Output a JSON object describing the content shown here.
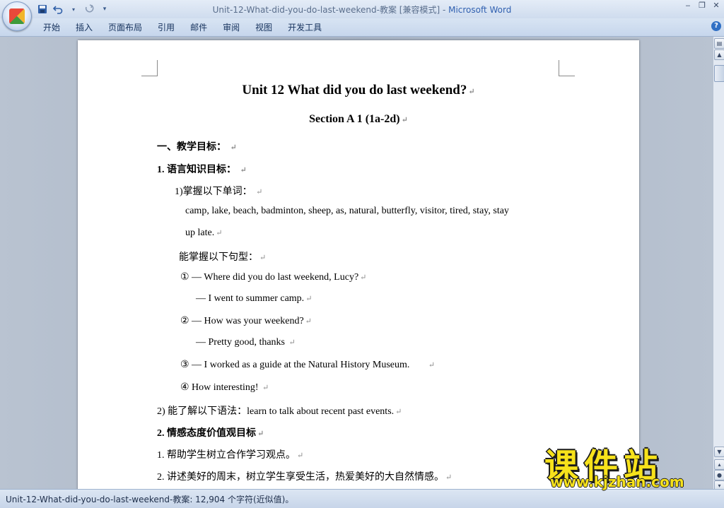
{
  "titlebar": {
    "doc_name": "Unit-12-What-did-you-do-last-weekend-教案 [兼容模式] - ",
    "app_name": "Microsoft Word",
    "qat_save_icon": "save-icon",
    "qat_undo_icon": "undo-icon",
    "qat_redo_icon": "redo-icon"
  },
  "ribbon": {
    "tabs": [
      "开始",
      "插入",
      "页面布局",
      "引用",
      "邮件",
      "审阅",
      "视图",
      "开发工具"
    ]
  },
  "document": {
    "title": "Unit 12 What did you do last weekend?",
    "section": "Section A 1 (1a-2d)",
    "h1": "一、教学目标：",
    "h2": "1. 语言知识目标：",
    "vocab_head": "1)掌握以下单词：",
    "vocab_line1": "camp, lake, beach, badminton, sheep, as, natural, butterfly, visitor, tired, stay, stay",
    "vocab_line2": "up late.",
    "patterns_head": "能掌握以下句型：",
    "s1": "① — Where did you do last weekend, Lucy?",
    "s1a": "— I went to summer camp.",
    "s2": "② — How was your weekend?",
    "s2a": "— Pretty good, thanks",
    "s3": "③ — I worked as a guide at the Natural History Museum.",
    "s4": "④ How interesting!",
    "grammar": "2) 能了解以下语法：learn to talk about recent past events.",
    "h3": "2. 情感态度价值观目标",
    "aim1": "1. 帮助学生树立合作学习观点。",
    "aim2": "2. 讲述美好的周末，树立学生享受生活，热爱美好的大自然情感。",
    "para_mark": "↵"
  },
  "statusbar": {
    "text": "Unit-12-What-did-you-do-last-weekend-教案: 12,904 个字符(近似值)。"
  },
  "watermark": {
    "cn": "课件站",
    "url": "www.kjzhan.com"
  }
}
